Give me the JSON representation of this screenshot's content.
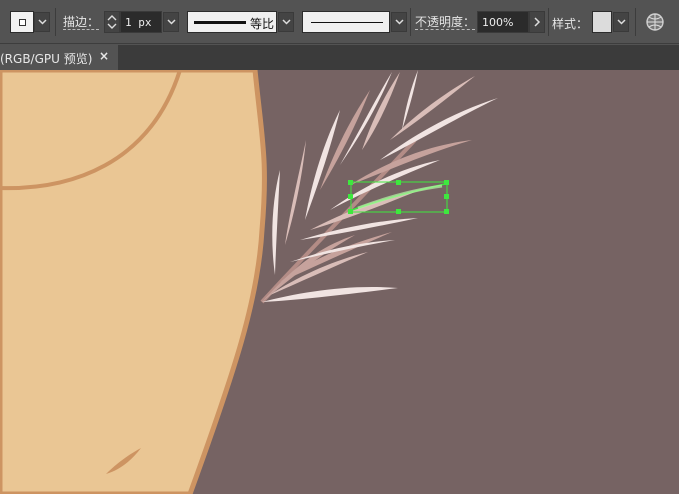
{
  "control_bar": {
    "stroke_label": "描边：",
    "stroke_weight": "1 px",
    "profile_label": "等比",
    "opacity_label": "不透明度：",
    "opacity_value": "100%",
    "style_label": "样式：",
    "icons": [
      "fill-swatch-icon",
      "chevron-down-icon",
      "stepper-icon",
      "chevron-right-icon",
      "globe-icon"
    ]
  },
  "tab": {
    "title": "(RGB/GPU 预览)",
    "close": "×"
  },
  "colors": {
    "ui_bg": "#535353",
    "tab_bar_bg": "#3b3b3b",
    "canvas_bg": "#766363",
    "face_fill": "#eac694",
    "face_outline": "#cd9462",
    "feather_light": "#f1e4e2",
    "feather_mid": "#d9bdb8",
    "feather_dark": "#c6a29c",
    "selection": "#3ee83e"
  }
}
